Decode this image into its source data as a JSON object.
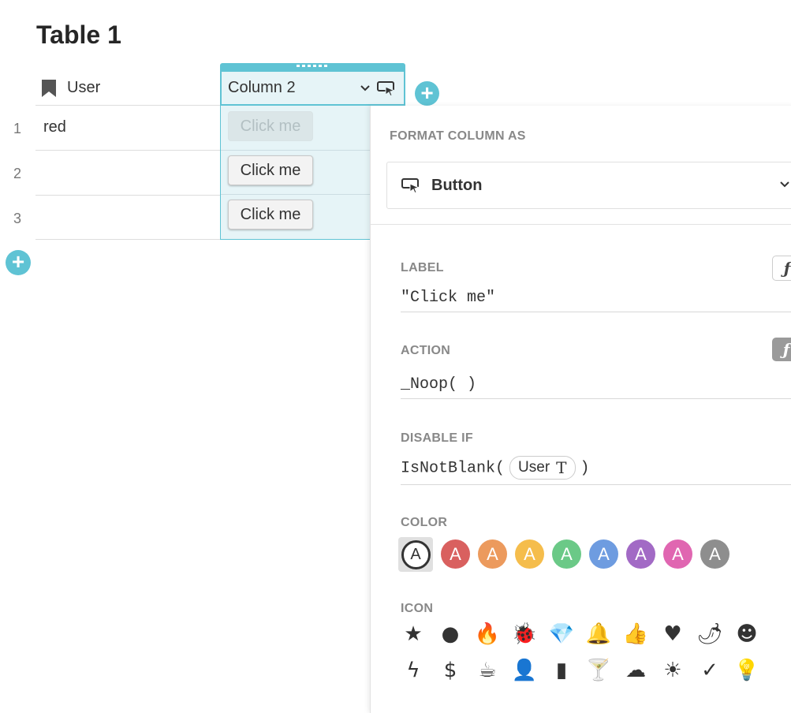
{
  "page": {
    "title": "Table 1"
  },
  "table": {
    "columns": [
      {
        "label": "User",
        "icon": "bookmark-icon"
      },
      {
        "label": "Column 2",
        "icon": "button-icon"
      }
    ],
    "rows": [
      {
        "num": "1",
        "user": "red",
        "button": "Click me",
        "disabled": true
      },
      {
        "num": "2",
        "user": "",
        "button": "Click me",
        "disabled": false
      },
      {
        "num": "3",
        "user": "",
        "button": "Click me",
        "disabled": false
      }
    ]
  },
  "panel": {
    "format_heading": "FORMAT COLUMN AS",
    "format_value": "Button",
    "label_heading": "LABEL",
    "label_formula": "\"Click me\"",
    "action_heading": "ACTION",
    "action_formula": "_Noop( )",
    "disable_heading": "DISABLE IF",
    "disable_prefix": "IsNotBlank(",
    "disable_ref": "User",
    "disable_suffix": ")",
    "formula_button_glyph": "ƒ",
    "color_heading": "COLOR",
    "colors": [
      {
        "name": "default",
        "hex": "#ffffff",
        "glyph": "A"
      },
      {
        "name": "red",
        "hex": "#d9605f",
        "glyph": "A"
      },
      {
        "name": "orange",
        "hex": "#ec9a5d",
        "glyph": "A"
      },
      {
        "name": "yellow",
        "hex": "#f5bd4c",
        "glyph": "A"
      },
      {
        "name": "green",
        "hex": "#6bc987",
        "glyph": "A"
      },
      {
        "name": "blue",
        "hex": "#6e9ce0",
        "glyph": "A"
      },
      {
        "name": "purple",
        "hex": "#a26ac5",
        "glyph": "A"
      },
      {
        "name": "pink",
        "hex": "#e066b1",
        "glyph": "A"
      },
      {
        "name": "gray",
        "hex": "#8e8e8e",
        "glyph": "A"
      }
    ],
    "icon_heading": "ICON",
    "icons": [
      {
        "name": "star-icon",
        "glyph": "★"
      },
      {
        "name": "circle-icon",
        "glyph": "●"
      },
      {
        "name": "fire-icon",
        "glyph": "🔥"
      },
      {
        "name": "bug-icon",
        "glyph": "🐞"
      },
      {
        "name": "diamond-icon",
        "glyph": "💎"
      },
      {
        "name": "bell-icon",
        "glyph": "🔔"
      },
      {
        "name": "thumbs-up-icon",
        "glyph": "👍"
      },
      {
        "name": "heart-icon",
        "glyph": "♥"
      },
      {
        "name": "chili-icon",
        "glyph": "🌶"
      },
      {
        "name": "smiley-icon",
        "glyph": "☻"
      },
      {
        "name": "lightning-icon",
        "glyph": "ϟ"
      },
      {
        "name": "dollar-icon",
        "glyph": "$"
      },
      {
        "name": "coffee-icon",
        "glyph": "☕"
      },
      {
        "name": "person-icon",
        "glyph": "👤"
      },
      {
        "name": "book-icon",
        "glyph": "▮"
      },
      {
        "name": "cocktail-icon",
        "glyph": "🍸"
      },
      {
        "name": "cloud-icon",
        "glyph": "☁"
      },
      {
        "name": "sun-icon",
        "glyph": "☀"
      },
      {
        "name": "check-icon",
        "glyph": "✓"
      },
      {
        "name": "lightbulb-icon",
        "glyph": "💡"
      }
    ]
  }
}
